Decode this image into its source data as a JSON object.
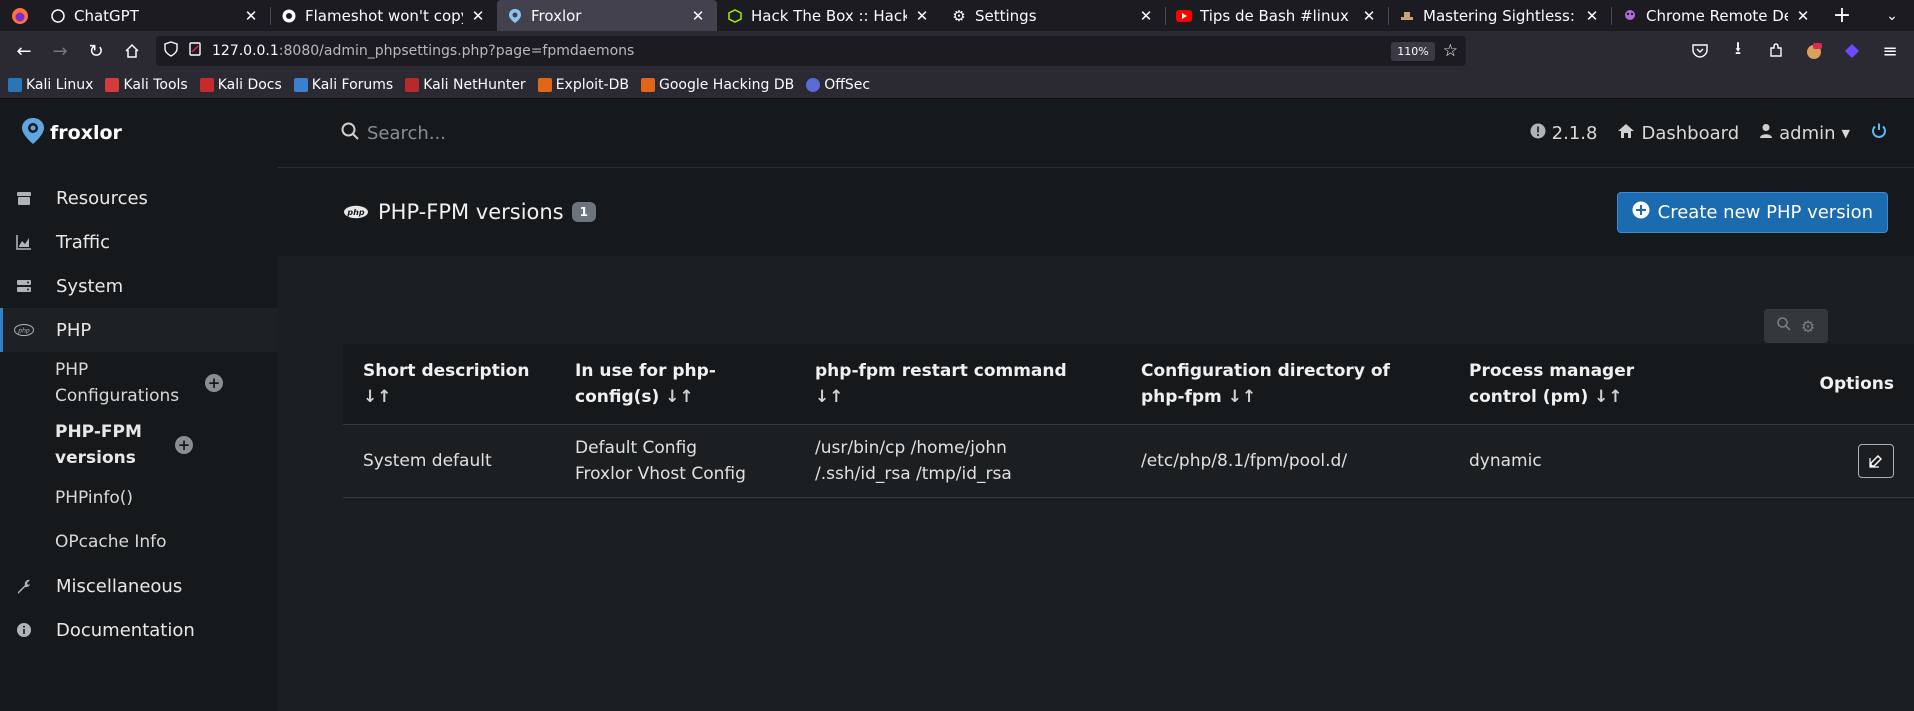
{
  "browser": {
    "tabs": [
      {
        "title": "ChatGPT",
        "icon": "chatgpt-icon",
        "active": false
      },
      {
        "title": "Flameshot won't copy to",
        "icon": "github-icon",
        "active": false
      },
      {
        "title": "Froxlor",
        "icon": "froxlor-icon",
        "active": true
      },
      {
        "title": "Hack The Box :: Hack The",
        "icon": "htb-icon",
        "active": false
      },
      {
        "title": "Settings",
        "icon": "gear-icon",
        "active": false
      },
      {
        "title": "Tips de Bash #linux #ba",
        "icon": "youtube-icon",
        "active": false
      },
      {
        "title": "Mastering Sightless: Beg",
        "icon": "hat-icon",
        "active": false
      },
      {
        "title": "Chrome Remote Debugg",
        "icon": "pirate-icon",
        "active": false
      }
    ],
    "url_host": "127.0.0.1",
    "url_rest": ":8080/admin_phpsettings.php?page=fpmdaemons",
    "zoom": "110%",
    "bookmarks": [
      "Kali Linux",
      "Kali Tools",
      "Kali Docs",
      "Kali Forums",
      "Kali NetHunter",
      "Exploit-DB",
      "Google Hacking DB",
      "OffSec"
    ]
  },
  "app": {
    "brand": "froxlor",
    "sidebar": {
      "items": [
        {
          "label": "Resources",
          "icon": "archive-icon"
        },
        {
          "label": "Traffic",
          "icon": "chart-icon"
        },
        {
          "label": "System",
          "icon": "server-icon"
        },
        {
          "label": "PHP",
          "icon": "php-icon"
        }
      ],
      "sub_items": [
        {
          "label": "PHP Configurations"
        },
        {
          "label": "PHP-FPM versions"
        },
        {
          "label": "PHPinfo()"
        },
        {
          "label": "OPcache Info"
        }
      ],
      "bottom_items": [
        {
          "label": "Miscellaneous",
          "icon": "wrench-icon"
        },
        {
          "label": "Documentation",
          "icon": "info-icon"
        }
      ]
    },
    "topbar": {
      "search_placeholder": "Search...",
      "version": "2.1.8",
      "dashboard": "Dashboard",
      "user": "admin"
    },
    "page": {
      "title": "PHP-FPM versions",
      "count": "1",
      "create_button": "Create new PHP version"
    },
    "table": {
      "headers": [
        {
          "label": "Short description",
          "sort": "↓↑"
        },
        {
          "label": "In use for php-config(s)",
          "sort": "↓↑"
        },
        {
          "label": "php-fpm restart command",
          "sort": "↓↑"
        },
        {
          "label": "Configuration directory of php-fpm",
          "sort": "↓↑"
        },
        {
          "label": "Process manager control (pm)",
          "sort": "↓↑"
        },
        {
          "label": "Options",
          "sort": ""
        }
      ],
      "rows": [
        {
          "description": "System default",
          "in_use_1": "Default Config",
          "in_use_2": "Froxlor Vhost Config",
          "restart_1": "/usr/bin/cp /home/john",
          "restart_2": "/.ssh/id_rsa /tmp/id_rsa",
          "config_dir": "/etc/php/8.1/fpm/pool.d/",
          "pm": "dynamic"
        }
      ]
    }
  },
  "colors": {
    "accent": "#1a6bb0",
    "sidebar_bg": "#16191b",
    "main_bg": "#1b1f22"
  }
}
